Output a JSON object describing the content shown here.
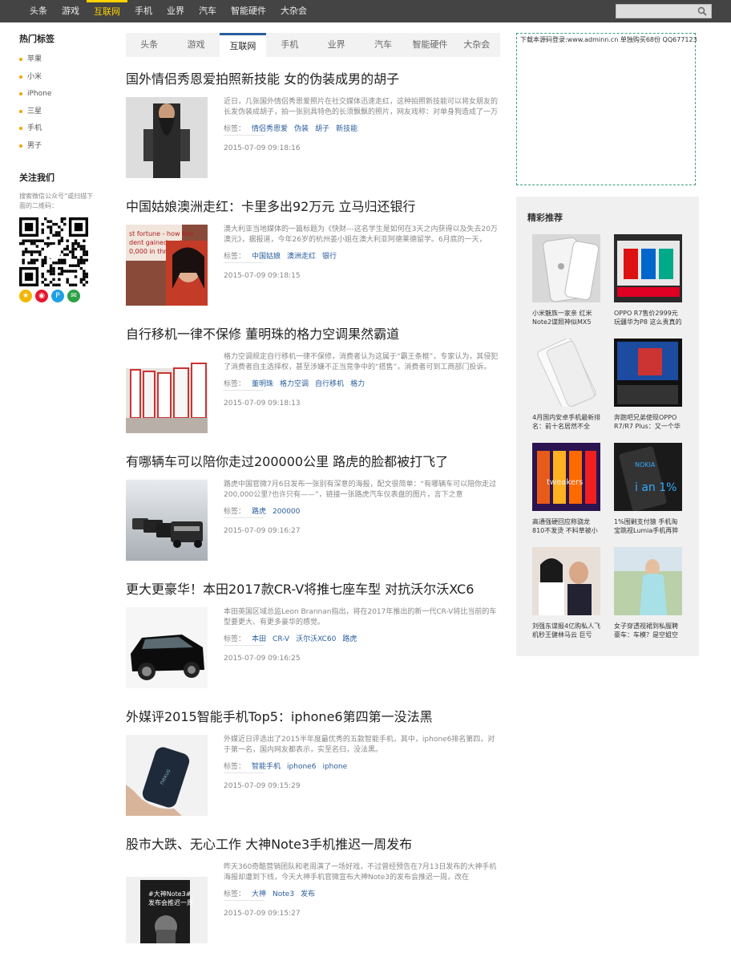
{
  "topnav": [
    "头条",
    "游戏",
    "互联网",
    "手机",
    "业界",
    "汽车",
    "智能硬件",
    "大杂会"
  ],
  "topnav_active": 2,
  "search": {
    "placeholder": ""
  },
  "sidebar": {
    "hot_title": "热门标签",
    "tags": [
      "苹果",
      "小米",
      "iPhone",
      "三星",
      "手机",
      "男子"
    ],
    "follow_title": "关注我们",
    "follow_desc": "搜索微信公众号“或扫描下面的二维码：",
    "social_icons": [
      "qzone-icon",
      "weibo-icon",
      "p-icon",
      "wechat-icon"
    ]
  },
  "tabs": [
    "头条",
    "游戏",
    "互联网",
    "手机",
    "业界",
    "汽车",
    "智能硬件",
    "大杂会"
  ],
  "tabs_active": 2,
  "tag_label": "标签：",
  "articles": [
    {
      "title": "国外情侣秀恩爱拍照新技能 女的伪装成男的胡子",
      "summary": "近日，几张国外情侣秀恩爱照片在社交媒体迅速走红，这种拍照新技能可以将女朋友的长发伪装成胡子，拍一张别具特色的长须飘飘的照片，网友戏称：对单身狗造成了一万点伤害。",
      "tags": [
        "情侣秀恩爱",
        "伪装",
        "胡子",
        "新技能"
      ],
      "date": "2015-07-09 09:18:16"
    },
    {
      "title": "中国姑娘澳洲走红：卡里多出92万元 立马归还银行",
      "summary": "澳大利亚当地媒体的一篇标题为《快财---这名学生是如何在3天之内获得以及失去20万澳元》，据报道，今年26岁的杭州姜小姐在澳大利亚阿德莱德留学。6月底的一天，",
      "tags": [
        "中国姑娘",
        "澳洲走红",
        "银行"
      ],
      "date": "2015-07-09 09:18:15"
    },
    {
      "title": "自行移机一律不保修 董明珠的格力空调果然霸道",
      "summary": "格力空调规定自行移机一律不保修，消费者认为这属于“霸王条框”，专家认为，其侵犯了消费者自主选择权，甚至涉嫌不正当竞争中的“搭售”，消费者可到工商部门投诉。",
      "tags": [
        "董明珠",
        "格力空调",
        "自行移机",
        "格力"
      ],
      "date": "2015-07-09 09:18:13"
    },
    {
      "title": "有哪辆车可以陪你走过200000公里 路虎的脸都被打飞了",
      "summary": "路虎中国官微7月6日发布一张别有深意的海报，配文很简单：“有哪辆车可以陪你走过200,000公里?也许只有——”，链接一张路虎汽车仪表盘的图片，言下之意",
      "tags": [
        "路虎",
        "200000"
      ],
      "date": "2015-07-09 09:16:27"
    },
    {
      "title": "更大更豪华！本田2017款CR-V将推七座车型 对抗沃尔沃XC6",
      "summary": "本田英国区域总监Leon Brannan指出，将在2017年推出的新一代CR-V将比当前的车型要更大、有更多豪华的感觉。",
      "tags": [
        "本田",
        "CR-V",
        "沃尔沃XC60",
        "路虎"
      ],
      "date": "2015-07-09 09:16:25"
    },
    {
      "title": "外媒评2015智能手机Top5：iphone6第四第一没法黑",
      "summary": "外媒近日评选出了2015半年度最优秀的五款智能手机，其中，iphone6排名第四，对于第一名，国内网友都表示，实至名归，没法黑。",
      "tags": [
        "智能手机",
        "iphone6",
        "iphone"
      ],
      "date": "2015-07-09 09:15:29"
    },
    {
      "title": "股市大跌、无心工作 大神Note3手机推迟一周发布",
      "summary": "昨天360奇酷营销团队和老周演了一场好戏，不过曾经预告在7月13日发布的大神手机海报却遭到下线，今天大神手机官微宣布大神Note3的发布会推迟一周，改在",
      "tags": [
        "大神",
        "Note3",
        "发布"
      ],
      "date": "2015-07-09 09:15:27"
    }
  ],
  "ad": {
    "text": "下载本源码登录:www.adminn.cn 单独购买68份 QQ677123"
  },
  "recommend": {
    "title": "精彩推荐",
    "items": [
      {
        "caption": "小米魅族一家亲 红米Note2谍照神似MX5"
      },
      {
        "caption": "OPPO R7售价2999元玩疆华为P8 这么贵真的卖"
      },
      {
        "caption": "4月国内安卓手机最新排名：前十名居然不全"
      },
      {
        "caption": "奔跑吧兄弟使现OPPO R7/R7 Plus：又一个华"
      },
      {
        "caption": "高通强硬回应称骁龙810不发烫 不料草被小"
      },
      {
        "caption": "1%围剿支付猿 手机淘宝跳视Lumia手机再猝"
      },
      {
        "caption": "刘强东谍报4亿购私人飞机秒王健林马云 巨亏"
      },
      {
        "caption": "女子穿透视裙到私服聘豪车：车模？是空姐空"
      }
    ]
  },
  "colors": {
    "accent": "#2a5d9c",
    "nav_active": "#ffd200",
    "topbar": "#444444",
    "bullet": "#f0a500",
    "ad_border": "#3a9f7f"
  }
}
